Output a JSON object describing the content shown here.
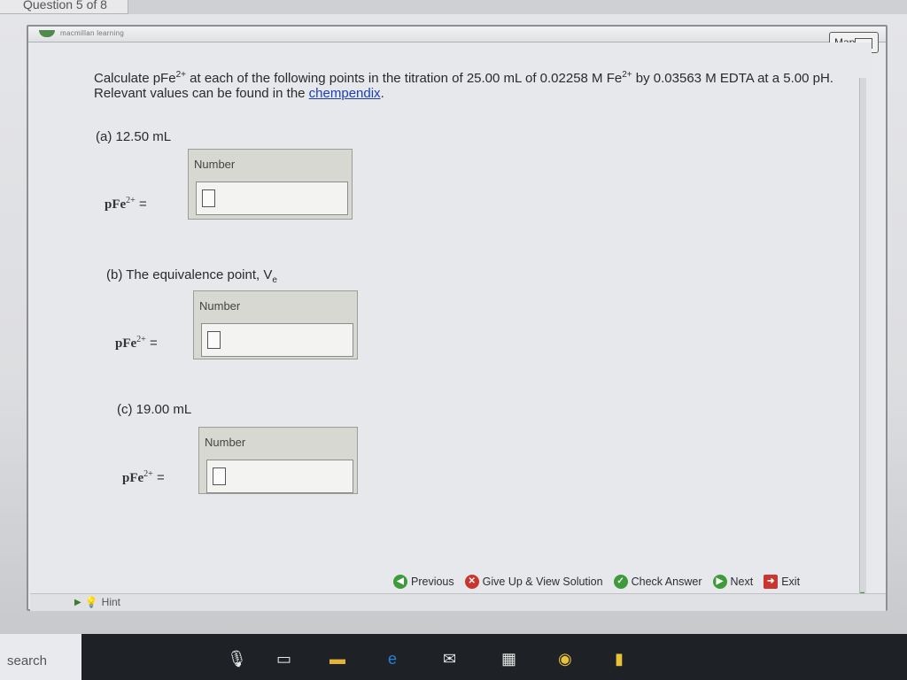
{
  "tab": {
    "title": "Question 5 of 8"
  },
  "header": {
    "brand": "macmillan learning",
    "map_label": "Map"
  },
  "question": {
    "part1": "Calculate pFe",
    "charge": "2+",
    "part2": " at each of the following points in the titration of 25.00 mL of 0.02258 M Fe",
    "part3": " by 0.03563 M EDTA at a 5.00 pH. Relevant values can be found in the ",
    "link": "chempendix",
    "part4": "."
  },
  "parts": [
    {
      "label": "(a) 12.50 mL",
      "number_label": "Number",
      "pfe": "pFe",
      "charge": "2+",
      "eq": " =",
      "value": ""
    },
    {
      "label": "(b) The equivalence point, V",
      "label_sub": "e",
      "number_label": "Number",
      "pfe": "pFe",
      "charge": "2+",
      "eq": " =",
      "value": ""
    },
    {
      "label": "(c) 19.00 mL",
      "number_label": "Number",
      "pfe": "pFe",
      "charge": "2+",
      "eq": " =",
      "value": ""
    }
  ],
  "footer": {
    "hint": "Hint",
    "previous": "Previous",
    "give_up": "Give Up & View Solution",
    "check": "Check Answer",
    "next": "Next",
    "exit": "Exit"
  },
  "taskbar": {
    "search": "search"
  },
  "colors": {
    "accent_green": "#3e9a3a",
    "accent_red": "#c8362f",
    "link_blue": "#1d3fb0"
  }
}
